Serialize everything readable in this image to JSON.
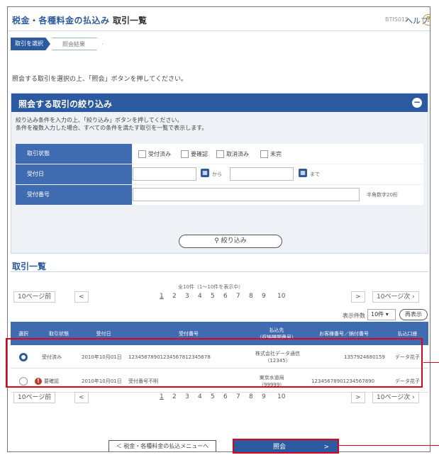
{
  "header": {
    "title": "税金・各種料金の払込み",
    "page": "取引一覧",
    "screen_code": "BTIS015",
    "help": "ヘルプ",
    "help_icon": "?"
  },
  "steps": [
    "取引を選択",
    "照会結果"
  ],
  "instruction": "照会する取引を選択の上、「照会」ボタンを押してください。",
  "filter": {
    "title": "照会する取引の絞り込み",
    "collapse_icon": "−",
    "desc1": "絞り込み条件を入力の上、「絞り込み」ボタンを押してください。",
    "desc2": "条件を複数入力した場合、すべての条件を満たす取引を一覧で表示します。",
    "status_label": "取引状態",
    "status_options": [
      "受付済み",
      "要確認",
      "取消済み",
      "未完"
    ],
    "date_label": "受付日",
    "date_from_suffix": "から",
    "date_to_suffix": "まで",
    "number_label": "受付番号",
    "number_hint": "半角数字20桁",
    "button": "絞り込み"
  },
  "list": {
    "title": "取引一覧",
    "count_text": "全10件（1～10件を表示中）",
    "prev10": "10ページ前",
    "prev": "<",
    "pages": [
      "1",
      "2",
      "3",
      "4",
      "5",
      "6",
      "7",
      "8",
      "9",
      "10"
    ],
    "next": ">",
    "next10": "10ページ次",
    "display_label": "表示件数",
    "display_value": "10件",
    "redisplay": "再表示",
    "columns": [
      "選択",
      "取引状態",
      "受付日",
      "受付番号",
      "払込先\n（収納機関番号）",
      "お客様番号／納付番号",
      "払込口座"
    ],
    "rows": [
      {
        "status": "受付済み",
        "date": "2010年10月01日",
        "number": "12345678901234567812345678",
        "payee": "株式会社データ通信\n（12345）",
        "customer": "1357924680159",
        "account": "データ花子"
      },
      {
        "status": "要確認",
        "date": "2010年10月01日",
        "number": "受付番号不明",
        "payee": "東京水道局\n（99999）",
        "customer": "12345678901234567890",
        "account": "データ花子"
      }
    ]
  },
  "buttons": {
    "back": "＜ 税金・各種料金の払込メニューへ",
    "inquiry": "照会",
    "inquiry_arrow": ">"
  }
}
